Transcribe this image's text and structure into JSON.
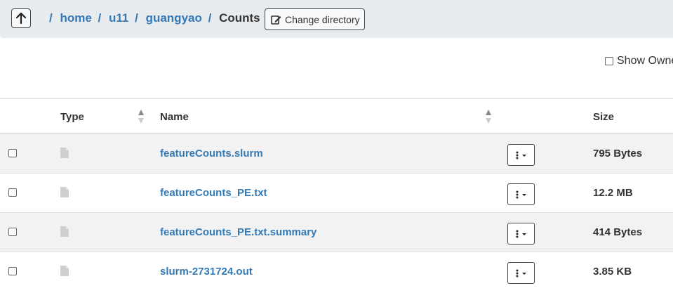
{
  "breadcrumb": {
    "segments": [
      "home",
      "u11",
      "guangyao"
    ],
    "current": "Counts",
    "separator": "/"
  },
  "toolbar": {
    "change_directory_label": "Change directory"
  },
  "options": {
    "show_owner_label": "Show Owne"
  },
  "table": {
    "headers": {
      "type": "Type",
      "name": "Name",
      "size": "Size"
    },
    "rows": [
      {
        "name": "featureCounts.slurm",
        "size": "795 Bytes"
      },
      {
        "name": "featureCounts_PE.txt",
        "size": "12.2 MB"
      },
      {
        "name": "featureCounts_PE.txt.summary",
        "size": "414 Bytes"
      },
      {
        "name": "slurm-2731724.out",
        "size": "3.85 KB"
      }
    ]
  },
  "colors": {
    "link": "#337ab7",
    "toolbar_bg": "#e9ecef",
    "stripe": "#f2f2f2"
  }
}
